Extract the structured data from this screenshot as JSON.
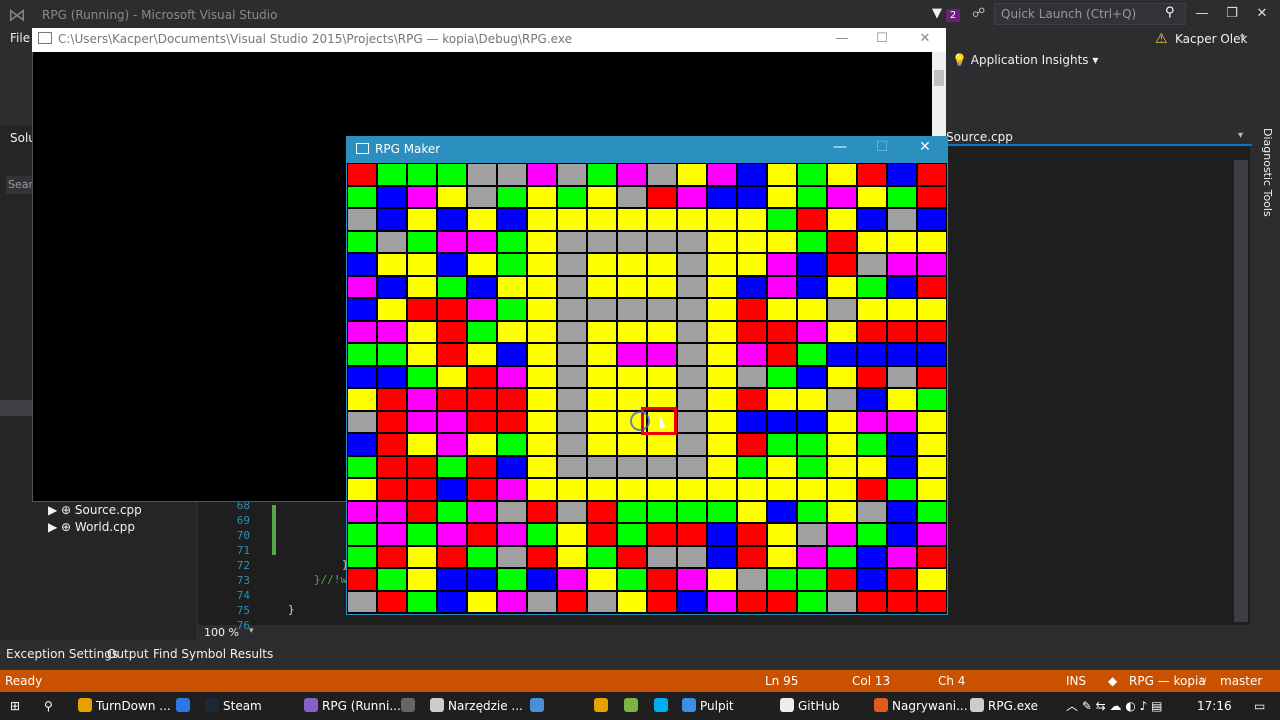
{
  "vs": {
    "title": "RPG (Running) - Microsoft Visual Studio",
    "notification_count": "2",
    "quick_launch_placeholder": "Quick Launch (Ctrl+Q)",
    "menu_file": "File",
    "account_name": "Kacper Olek",
    "application_insights": "Application Insights",
    "solution_label": "Solu",
    "search_label": "Sear",
    "tree": [
      "Source.cpp",
      "World.cpp"
    ],
    "doc_tab": "Source.cpp",
    "diagnostic_tools": "Diagnostic Tools",
    "line_numbers": [
      "68",
      "69",
      "70",
      "71",
      "72",
      "73",
      "74",
      "75",
      "76"
    ],
    "code_comment": "}//!w",
    "code_close": "}",
    "code_brace": "}",
    "zoom": "100 %"
  },
  "tool_tabs": [
    "Exception Settings",
    "Output",
    "Find Symbol Results"
  ],
  "status": {
    "ready": "Ready",
    "ln": "Ln 95",
    "col": "Col 13",
    "ch": "Ch 4",
    "ins": "INS",
    "project": "RPG — kopia",
    "branch": "master"
  },
  "console": {
    "title": "C:\\Users\\Kacper\\Documents\\Visual Studio 2015\\Projects\\RPG — kopia\\Debug\\RPG.exe"
  },
  "rpg": {
    "title": "RPG Maker",
    "palette": {
      "R": "#ff0000",
      "G": "#00ff00",
      "B": "#0000ff",
      "M": "#ff00ff",
      "Y": "#ffff00",
      "S": "#a0a0a0"
    },
    "rows": [
      "RGGGSSMSGMSYMBYGYRBR",
      "GBMYSGYGYSRMBBYGMYGR",
      "SBYBYBYYYYYYYYGRYBSB",
      "GSGMMGYSSSSSYYYGRYYY",
      "BYYBYGYSYYYSYYMBRSMM",
      "MBYGBYYSYYYSYBMBYGBR",
      "BYRRMGYSSSSSYRYYSYYY",
      "MMYRGYYSYYYSYRRMYRRR",
      "GGYRYBYSYMMSYMRGBBBB",
      "BBGYRMYSYYYSYSGBYRSR",
      "YRMRRRYSYYYSYRYYSBYG",
      "SRMMRRYSYYYSYBBBYMMY",
      "BRYMYGYSYYYSYRGGYGBY",
      "GRRGRBYSSSSSYGYGYYBY",
      "YRRBRMYYYYYYYYYYYRGY",
      "MMRGMSRSRGGGGYBGYSBG",
      "GMGMRMGYRGRRBRYSMGBM",
      "GRYRGSRYGRSSBRYMGBMR",
      "RGYBBGBMYGRMYSGGRBRY",
      "SRGBYMSRSYRBMRRGSRRR"
    ]
  },
  "taskbar": [
    {
      "label": "TurnDown ...",
      "icon": "chrome-icon",
      "color": "#e8a000"
    },
    {
      "label": "",
      "icon": "edge-icon",
      "color": "#2b78e4"
    },
    {
      "label": "Steam",
      "icon": "steam-icon",
      "color": "#1b2838"
    },
    {
      "label": "RPG (Runni...",
      "icon": "visual-studio-icon",
      "color": "#8661c5"
    },
    {
      "label": "",
      "icon": "app-icon",
      "color": "#666666"
    },
    {
      "label": "Narzędzie ...",
      "icon": "snipping-tool-icon",
      "color": "#cccccc"
    },
    {
      "label": "",
      "icon": "package-icon",
      "color": "#4a90d9"
    },
    {
      "label": "",
      "icon": "lock-icon",
      "color": "#e8a000"
    },
    {
      "label": "",
      "icon": "android-icon",
      "color": "#7cb342"
    },
    {
      "label": "",
      "icon": "skype-icon",
      "color": "#00aff0"
    },
    {
      "label": "Pulpit",
      "icon": "folder-icon",
      "color": "#3d8ee6"
    },
    {
      "label": "GitHub",
      "icon": "github-icon",
      "color": "#eeeeee"
    },
    {
      "label": "Nagrywani...",
      "icon": "recorder-icon",
      "color": "#e05a1c"
    },
    {
      "label": "RPG.exe",
      "icon": "window-icon",
      "color": "#cccccc"
    }
  ],
  "clock": "17:16"
}
